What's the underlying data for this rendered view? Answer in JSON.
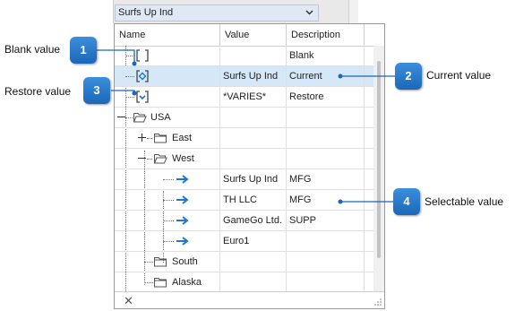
{
  "combo": {
    "value": "Surfs Up Ind"
  },
  "columns": {
    "name": "Name",
    "value": "Value",
    "description": "Description"
  },
  "rows": [
    {
      "name": "",
      "value": "",
      "description": "Blank"
    },
    {
      "name": "",
      "value": "Surfs Up Ind",
      "description": "Current"
    },
    {
      "name": "",
      "value": "*VARIES*",
      "description": "Restore"
    },
    {
      "name": "USA",
      "value": "",
      "description": ""
    },
    {
      "name": "East",
      "value": "",
      "description": ""
    },
    {
      "name": "West",
      "value": "",
      "description": ""
    },
    {
      "name": "",
      "value": "Surfs Up Ind",
      "description": "MFG"
    },
    {
      "name": "",
      "value": "TH LLC",
      "description": "MFG"
    },
    {
      "name": "",
      "value": "GameGo Ltd.",
      "description": "SUPP"
    },
    {
      "name": "",
      "value": "Euro1",
      "description": ""
    },
    {
      "name": "South",
      "value": "",
      "description": ""
    },
    {
      "name": "Alaska",
      "value": "",
      "description": ""
    }
  ],
  "callouts": [
    {
      "number": "1",
      "label": "Blank value"
    },
    {
      "number": "2",
      "label": "Current value"
    },
    {
      "number": "3",
      "label": "Restore value"
    },
    {
      "number": "4",
      "label": "Selectable value"
    }
  ],
  "footer": {
    "close_glyph": "✕"
  },
  "colors": {
    "accent": "#1b67b8",
    "selected_row": "#d6e7f7",
    "arrow": "#1f77d0"
  }
}
